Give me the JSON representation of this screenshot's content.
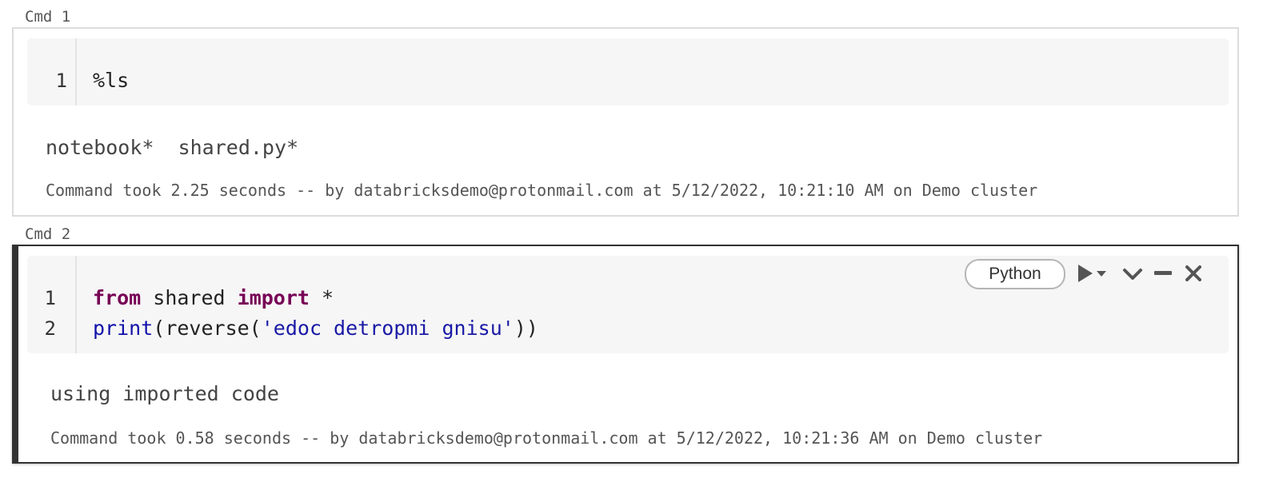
{
  "cells": [
    {
      "label": "Cmd 1",
      "lines": [
        {
          "num": "1",
          "code": "%ls"
        }
      ],
      "output": "notebook*  shared.py*",
      "took": "Command took 2.25 seconds -- by databricksdemo@protonmail.com at 5/12/2022, 10:21:10 AM on Demo cluster"
    },
    {
      "label": "Cmd 2",
      "language": "Python",
      "lines": [
        {
          "num": "1",
          "kw1": "from",
          "mid": " shared ",
          "kw2": "import",
          "rest": " *"
        },
        {
          "num": "2",
          "fn": "print",
          "open": "(reverse(",
          "str": "'edoc detropmi gnisu'",
          "close": "))"
        }
      ],
      "output": "using imported code",
      "took": "Command took 0.58 seconds -- by databricksdemo@protonmail.com at 5/12/2022, 10:21:36 AM on Demo cluster",
      "toolbar": [
        "run-dropdown-icon",
        "chevron-down-icon",
        "minimize-icon",
        "close-icon"
      ]
    }
  ],
  "colors": {
    "keyword": "#770055",
    "builtin": "#1111aa",
    "string": "#1a1aa6",
    "editor_bg": "#f6f6f6",
    "active_border": "#333333"
  }
}
